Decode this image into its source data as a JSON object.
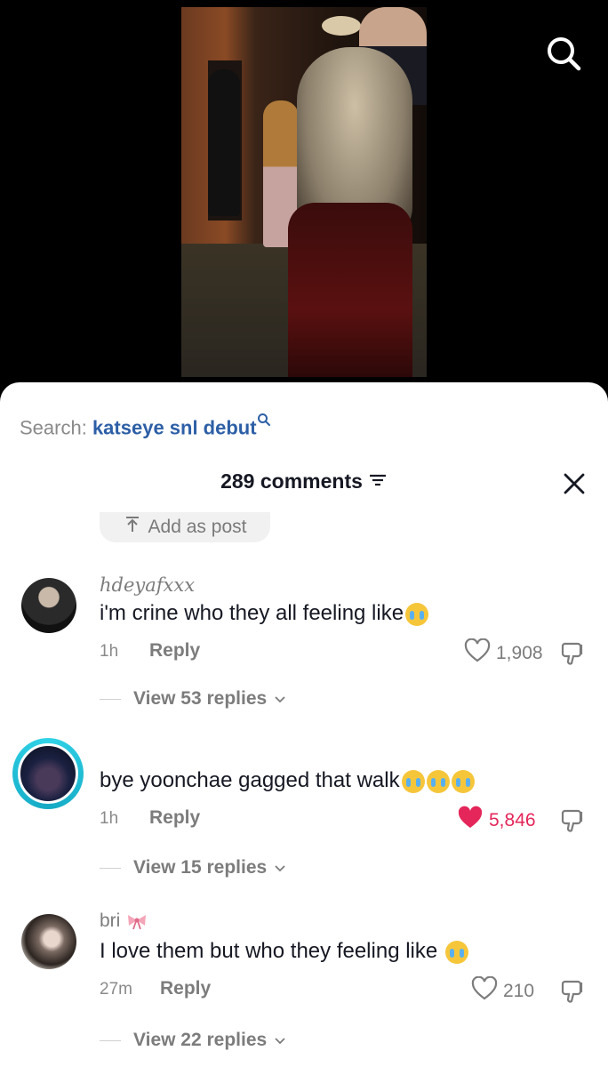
{
  "video": {
    "search_icon": "search-icon"
  },
  "search": {
    "prefix": "Search: ",
    "query": "katseye snl debut"
  },
  "comments_header": {
    "count_label": "289 comments",
    "filter_icon": "filter-icon",
    "close_icon": "close-icon"
  },
  "add_post": {
    "label": "Add as post"
  },
  "comments": [
    {
      "username": "hdeyafxxx",
      "text": "i'm crine who they all feeling like",
      "emojis": [
        "loudly-crying-face"
      ],
      "time": "1h",
      "reply_label": "Reply",
      "likes": "1,908",
      "liked": false,
      "view_replies": "View 53 replies"
    },
    {
      "username": "",
      "text": "bye yoonchae gagged that walk",
      "emojis": [
        "loudly-crying-face",
        "loudly-crying-face",
        "loudly-crying-face"
      ],
      "time": "1h",
      "reply_label": "Reply",
      "likes": "5,846",
      "liked": true,
      "view_replies": "View 15 replies"
    },
    {
      "username": "bri",
      "text": "I love them but who they feeling like",
      "emojis": [
        "loudly-crying-face"
      ],
      "time": "27m",
      "reply_label": "Reply",
      "likes": "210",
      "liked": false,
      "view_replies": "View 22 replies"
    }
  ],
  "colors": {
    "accent_blue": "#2d5fa6",
    "liked_red": "#e4265a",
    "story_ring": "#2fd3e8"
  }
}
